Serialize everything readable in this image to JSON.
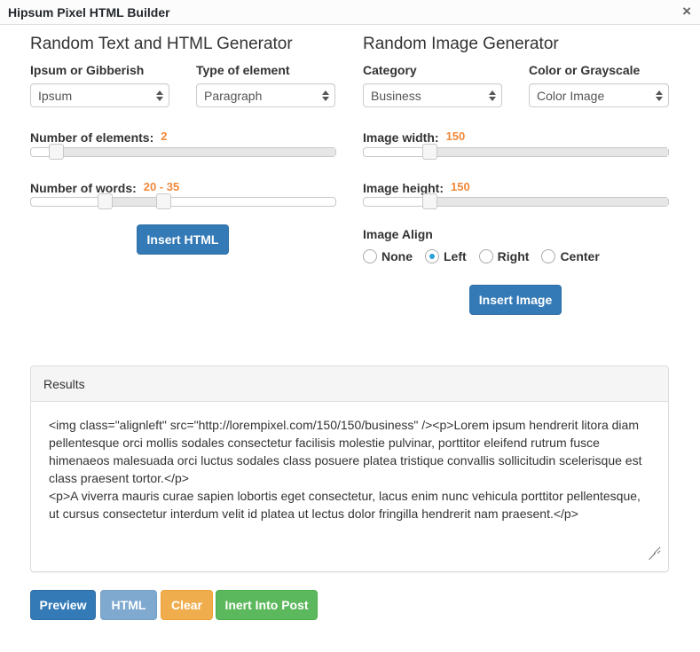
{
  "window": {
    "title": "Hipsum Pixel HTML Builder",
    "close_icon": "×"
  },
  "text_generator": {
    "heading": "Random Text and HTML Generator",
    "ipsum_label": "Ipsum or Gibberish",
    "ipsum_value": "Ipsum",
    "type_label": "Type of element",
    "type_value": "Paragraph",
    "elements_label": "Number of elements:",
    "elements_value": "2",
    "elements_slider": {
      "min": 1,
      "max": 20,
      "value": 2
    },
    "words_label": "Number of words:",
    "words_value": "20 - 35",
    "words_slider": {
      "min": 1,
      "max": 150,
      "low": 20,
      "high": 35
    },
    "insert_button": "Insert HTML"
  },
  "image_generator": {
    "heading": "Random Image Generator",
    "category_label": "Category",
    "category_value": "Business",
    "color_label": "Color or Grayscale",
    "color_value": "Color Image",
    "width_label": "Image width:",
    "width_value": "150",
    "width_slider": {
      "min": 0,
      "max": 800,
      "value": 150
    },
    "height_label": "Image height:",
    "height_value": "150",
    "height_slider": {
      "min": 0,
      "max": 800,
      "value": 150
    },
    "align_label": "Image Align",
    "align_options": [
      {
        "label": "None",
        "checked": false
      },
      {
        "label": "Left",
        "checked": true
      },
      {
        "label": "Right",
        "checked": false
      },
      {
        "label": "Center",
        "checked": false
      }
    ],
    "insert_button": "Insert Image"
  },
  "results": {
    "heading": "Results",
    "content": "<img class=\"alignleft\" src=\"http://lorempixel.com/150/150/business\" /><p>Lorem ipsum hendrerit litora diam pellentesque orci mollis sodales consectetur facilisis molestie pulvinar, porttitor eleifend rutrum fusce himenaeos malesuada orci luctus sodales class posuere platea tristique convallis sollicitudin scelerisque est class praesent tortor.</p>\n<p>A viverra mauris curae sapien lobortis eget consectetur, lacus enim nunc vehicula porttitor pellentesque, ut cursus consectetur interdum velit id platea ut lectus dolor fringilla hendrerit nam praesent.</p>"
  },
  "actions": {
    "preview": "Preview",
    "html": "HTML",
    "clear": "Clear",
    "insert_post": "Inert Into Post"
  },
  "colors": {
    "primary": "#337ab7",
    "accent_value": "#f0883a",
    "warning": "#f0ad4e",
    "success": "#5cb85c",
    "radio_checked": "#2b9fd9"
  }
}
